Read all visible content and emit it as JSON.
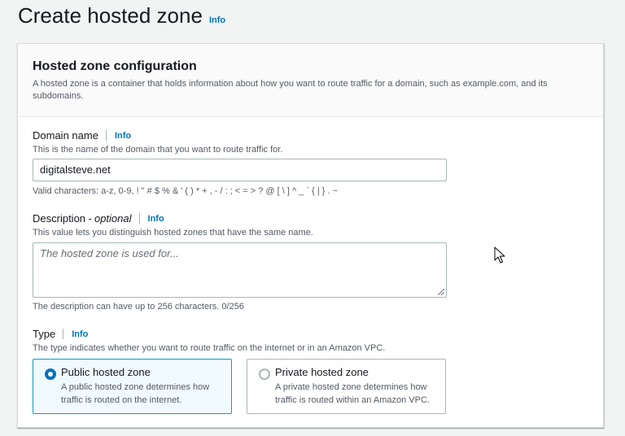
{
  "page": {
    "title": "Create hosted zone",
    "info": "Info"
  },
  "panel": {
    "title": "Hosted zone configuration",
    "description": "A hosted zone is a container that holds information about how you want to route traffic for a domain, such as example.com, and its subdomains."
  },
  "domain": {
    "label": "Domain name",
    "info": "Info",
    "description": "This is the name of the domain that you want to route traffic for.",
    "value": "digitalsteve.net",
    "constraint": "Valid characters: a-z, 0-9, ! \" # $ % & ' ( ) * + , - / : ; < = > ? @ [ \\ ] ^ _ ` { | } . ~"
  },
  "description_field": {
    "label": "Description - ",
    "label_optional": "optional",
    "info": "Info",
    "description": "This value lets you distinguish hosted zones that have the same name.",
    "placeholder": "The hosted zone is used for...",
    "constraint": "The description can have up to 256 characters. 0/256"
  },
  "type": {
    "label": "Type",
    "info": "Info",
    "description": "The type indicates whether you want to route traffic on the internet or in an Amazon VPC.",
    "options": [
      {
        "title": "Public hosted zone",
        "description": "A public hosted zone determines how traffic is routed on the internet.",
        "selected": true
      },
      {
        "title": "Private hosted zone",
        "description": "A private hosted zone determines how traffic is routed within an Amazon VPC.",
        "selected": false
      }
    ]
  },
  "colors": {
    "accent": "#0073bb",
    "selected_border": "#00a1c9",
    "selected_bg": "#f1faff"
  },
  "icons": {
    "cursor": "mouse-pointer-icon",
    "resize": "resize-grip-icon"
  }
}
